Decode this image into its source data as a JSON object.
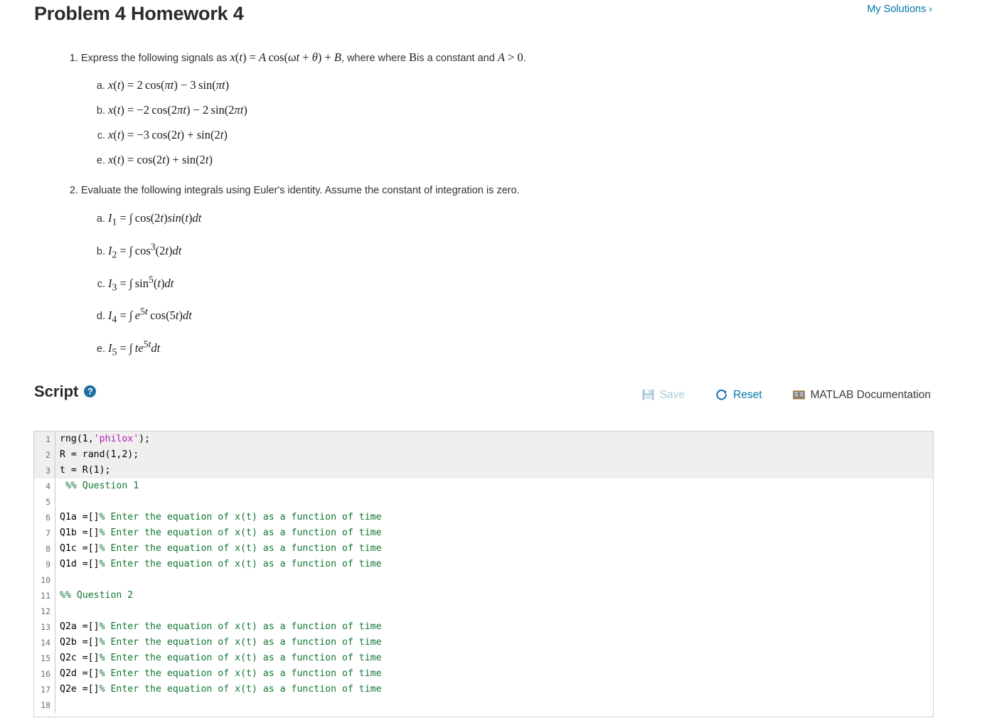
{
  "header": {
    "title": "Problem 4 Homework 4",
    "my_solutions_label": "My Solutions",
    "chevron": "›"
  },
  "problem": {
    "questions": [
      {
        "number": "1",
        "prompt_pre": "Express the following signals as",
        "prompt_math": "x(t) = A cos(ωt + θ) + B",
        "prompt_mid": ", where",
        "prompt_math2": "B",
        "prompt_post": "is a constant  and",
        "prompt_math3": "A > 0",
        "prompt_end": ".",
        "items": [
          {
            "letter": "a.",
            "math": "x(t) = 2 cos(πt) − 3 sin(πt)"
          },
          {
            "letter": "b.",
            "math": "x(t) = −2 cos(2πt) − 2 sin(2πt)"
          },
          {
            "letter": "c.",
            "math": "x(t) = −3 cos(2t) + sin(2t)"
          },
          {
            "letter": "e.",
            "math": "x(t) = cos(2t) + sin(2t)"
          }
        ]
      },
      {
        "number": "2",
        "prompt": "Evaluate the following integrals using Euler's identity. Assume the constant of integration is zero.",
        "items": [
          {
            "letter": "a.",
            "math": "I₁ = ∫ cos(2t)sin(t)dt"
          },
          {
            "letter": "b.",
            "math": "I₂ = ∫ cos³(2t)dt"
          },
          {
            "letter": "c.",
            "math": "I₃ = ∫ sin⁵(t)dt"
          },
          {
            "letter": "d.",
            "math": "I₄ = ∫ e⁵ᵗ cos(5t)dt"
          },
          {
            "letter": "e.",
            "math": "I₅ = ∫ te⁵ᵗdt"
          }
        ]
      }
    ]
  },
  "script": {
    "title": "Script",
    "help_tooltip": "?",
    "tools": {
      "save_label": "Save",
      "reset_label": "Reset",
      "doc_label": "MATLAB Documentation"
    },
    "readonly_lines": 3,
    "code": [
      {
        "n": "1",
        "segments": [
          {
            "t": "rng(1,",
            "c": "plain"
          },
          {
            "t": "'philox'",
            "c": "str"
          },
          {
            "t": ");",
            "c": "plain"
          }
        ]
      },
      {
        "n": "2",
        "segments": [
          {
            "t": "R = rand(1,2);",
            "c": "plain"
          }
        ]
      },
      {
        "n": "3",
        "segments": [
          {
            "t": "t = R(1);",
            "c": "plain"
          }
        ]
      },
      {
        "n": "4",
        "segments": [
          {
            "t": " %% Question 1",
            "c": "sec"
          }
        ]
      },
      {
        "n": "5",
        "segments": []
      },
      {
        "n": "6",
        "segments": [
          {
            "t": "Q1a =[]",
            "c": "plain"
          },
          {
            "t": "% Enter the equation of x(t) as a function of time",
            "c": "com"
          }
        ]
      },
      {
        "n": "7",
        "segments": [
          {
            "t": "Q1b =[]",
            "c": "plain"
          },
          {
            "t": "% Enter the equation of x(t) as a function of time",
            "c": "com"
          }
        ]
      },
      {
        "n": "8",
        "segments": [
          {
            "t": "Q1c =[]",
            "c": "plain"
          },
          {
            "t": "% Enter the equation of x(t) as a function of time",
            "c": "com"
          }
        ]
      },
      {
        "n": "9",
        "segments": [
          {
            "t": "Q1d =[]",
            "c": "plain"
          },
          {
            "t": "% Enter the equation of x(t) as a function of time",
            "c": "com"
          }
        ]
      },
      {
        "n": "10",
        "segments": []
      },
      {
        "n": "11",
        "segments": [
          {
            "t": "%% Question 2",
            "c": "sec"
          }
        ]
      },
      {
        "n": "12",
        "segments": []
      },
      {
        "n": "13",
        "segments": [
          {
            "t": "Q2a =[]",
            "c": "plain"
          },
          {
            "t": "% Enter the equation of x(t) as a function of time",
            "c": "com"
          }
        ]
      },
      {
        "n": "14",
        "segments": [
          {
            "t": "Q2b =[]",
            "c": "plain"
          },
          {
            "t": "% Enter the equation of x(t) as a function of time",
            "c": "com"
          }
        ]
      },
      {
        "n": "15",
        "segments": [
          {
            "t": "Q2c =[]",
            "c": "plain"
          },
          {
            "t": "% Enter the equation of x(t) as a function of time",
            "c": "com"
          }
        ]
      },
      {
        "n": "16",
        "segments": [
          {
            "t": "Q2d =[]",
            "c": "plain"
          },
          {
            "t": "% Enter the equation of x(t) as a function of time",
            "c": "com"
          }
        ]
      },
      {
        "n": "17",
        "segments": [
          {
            "t": "Q2e =[]",
            "c": "plain"
          },
          {
            "t": "% Enter the equation of x(t) as a function of time",
            "c": "com"
          }
        ]
      },
      {
        "n": "18",
        "segments": []
      }
    ]
  },
  "colors": {
    "link": "#0076a8",
    "comment": "#117733",
    "string": "#b020b0",
    "disabled": "#a9c9dd",
    "readonly_bg": "#efefef",
    "help_badge": "#1f6fa5",
    "doc_spine": "#c08a3e"
  }
}
